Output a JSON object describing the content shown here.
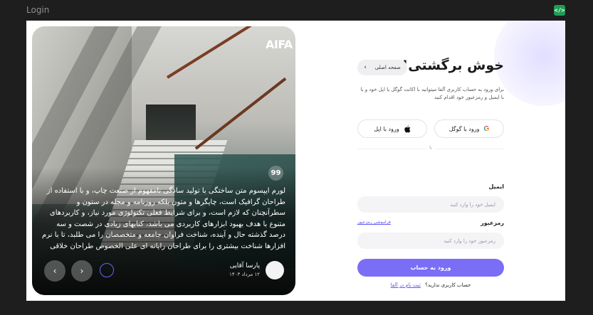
{
  "window": {
    "title": "Login"
  },
  "hero": {
    "logo": "AIFA",
    "quote_icon": "99",
    "quote": "لورم ایپسوم متن ساختگی با تولید سادگی نامفهوم از صنعت چاپ، و با استفاده از طراحان گرافیک است، چاپگرها و متون بلکه روزنامه و مجله در ستون و سطرآنچنان که لازم است، و برای شرایط فعلی تکنولوژی مورد نیاز، و کاربردهای متنوع با هدف بهبود ابزارهای کاربردی می باشد، کتابهای زیادی در شصت و سه درصد گذشته حال و آینده، شناخت فراوان جامعه و متخصصان را می طلبد، تا با نرم افزارها شناخت بیشتری را برای طراحان رایانه ای علی الخصوص طراحان خلاقی",
    "author_name": "پارسا آقایی",
    "author_date": "۱۲ مرداد ۱۴۰۳",
    "prev_icon": "‹",
    "next_icon": "›"
  },
  "form": {
    "heading": "خوش برگشتی!",
    "home_button": "صفحه اصلی",
    "home_chevron": "›",
    "subtitle": "برای ورود به حساب کاربری آلفا میتوانید با اکانت گوگل یا اپل خود و یا با ایمیل و رمزعبور خود اقدام کنید",
    "google_label": "ورود با گوگل",
    "google_icon": "G",
    "apple_label": "ورود با اپل",
    "divider": "یا",
    "email_label": "ایمیل",
    "email_placeholder": "ایمیل خود را وارد کنید",
    "password_label": "رمزعبور",
    "password_placeholder": "رمزعبور خود را وارد کنید",
    "forgot_link": "فراموشی رمزعبور",
    "submit": "ورود به حساب",
    "no_account": "حساب کاربری ندارید؟",
    "signup_link": "ثبت نام در آلفا"
  },
  "colors": {
    "accent": "#7a6ef7",
    "link": "#5b54f6",
    "code_badge": "#1f9d55"
  }
}
